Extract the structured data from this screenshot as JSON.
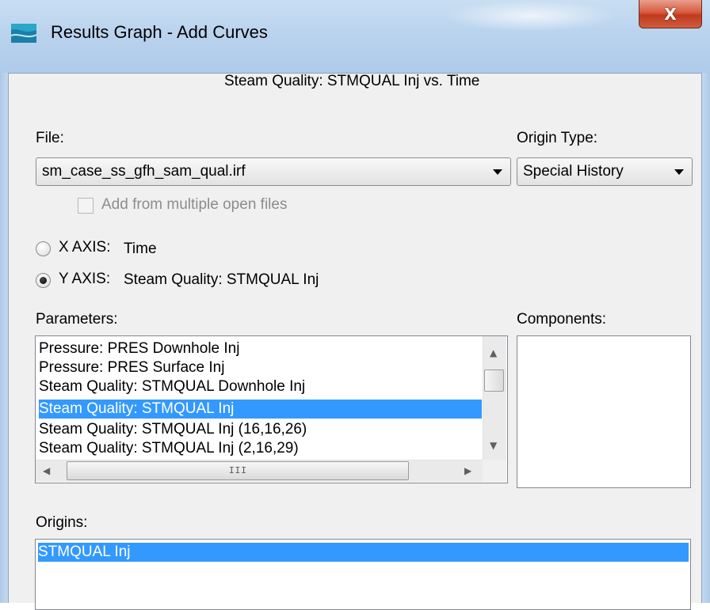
{
  "window": {
    "title": "Results Graph - Add Curves",
    "close_glyph": "X"
  },
  "header": {
    "subtitle": "Steam Quality: STMQUAL Inj vs. Time"
  },
  "file": {
    "label": "File:",
    "value": "sm_case_ss_gfh_sam_qual.irf",
    "add_multiple_label": "Add from multiple open files",
    "add_multiple_checked": false,
    "add_multiple_enabled": false
  },
  "origin_type": {
    "label": "Origin Type:",
    "value": "Special History"
  },
  "axes": {
    "x_label": "X AXIS:",
    "x_value": "Time",
    "x_selected": false,
    "y_label": "Y AXIS:",
    "y_value": "Steam Quality: STMQUAL Inj",
    "y_selected": true
  },
  "parameters": {
    "label": "Parameters:",
    "items": [
      "Pressure: PRES Downhole Inj",
      "Pressure: PRES Surface Inj",
      "Steam Quality: STMQUAL Downhole Inj",
      "Steam Quality: STMQUAL Inj",
      "Steam Quality: STMQUAL Inj (16,16,26)",
      "Steam Quality: STMQUAL Inj (2,16,29)"
    ],
    "selected_index": 3,
    "grip": "III"
  },
  "components": {
    "label": "Components:"
  },
  "origins": {
    "label": "Origins:",
    "items": [
      "STMQUAL Inj"
    ],
    "selected_index": 0
  },
  "colors": {
    "selection": "#3399ff",
    "close_button": "#c7432a",
    "dialog_bg": "#f0f0f0"
  }
}
